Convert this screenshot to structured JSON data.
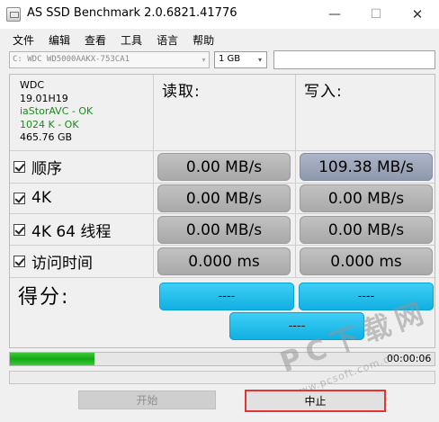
{
  "window": {
    "title": "AS SSD Benchmark 2.0.6821.41776",
    "minimize_glyph": "—",
    "maximize_glyph": "☐",
    "close_glyph": "✕"
  },
  "menu": [
    "文件",
    "编辑",
    "查看",
    "工具",
    "语言",
    "帮助"
  ],
  "toolbar": {
    "drive": "C: WDC WD5000AAKX-753CA1",
    "size": "1 GB",
    "dropdown_glyph": "▾",
    "name_value": ""
  },
  "drive_info": {
    "model": "WDC",
    "firmware": "19.01H19",
    "driver": "iaStorAVC - OK",
    "alignment": "1024 K - OK",
    "capacity": "465.76 GB"
  },
  "columns": {
    "read": "读取:",
    "write": "写入:"
  },
  "rows": [
    {
      "label": "顺序",
      "checked": true,
      "read": "0.00 MB/s",
      "write": "109.38 MB/s"
    },
    {
      "label": "4K",
      "checked": true,
      "read": "0.00 MB/s",
      "write": "0.00 MB/s"
    },
    {
      "label": "4K 64 线程",
      "checked": true,
      "read": "0.00 MB/s",
      "write": "0.00 MB/s"
    },
    {
      "label": "访问时间",
      "checked": true,
      "read": "0.000 ms",
      "write": "0.000 ms"
    }
  ],
  "score": {
    "label": "得分:",
    "read": "----",
    "write": "----",
    "total": "----"
  },
  "progress": {
    "fraction": 0.2,
    "elapsed": "00:00:06"
  },
  "buttons": {
    "start": "开始",
    "abort": "中止"
  },
  "watermark": {
    "text": "PC下载网",
    "url": "www.pcsoft.com.cn"
  },
  "colors": {
    "score_blue": "#1ab8e8",
    "result_gray": "#b5b5b5",
    "result_highlight": "#9aa2b6",
    "ok_green": "#1a8a1a",
    "progress_green": "#22b322",
    "abort_outline": "#e23434"
  }
}
